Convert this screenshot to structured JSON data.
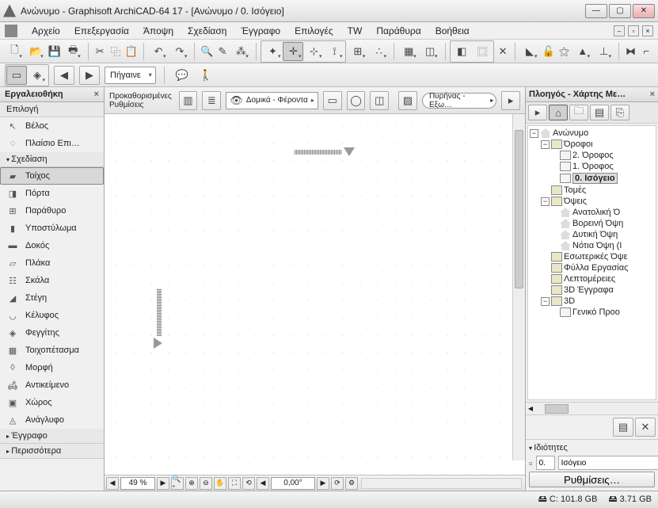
{
  "window": {
    "title": "Ανώνυμο - Graphisoft ArchiCAD-64 17 - [Ανώνυμο / 0. Ισόγειο]"
  },
  "menu": {
    "items": [
      "Αρχείο",
      "Επεξεργασία",
      "Άποψη",
      "Σχεδίαση",
      "Έγγραφο",
      "Επιλογές",
      "TW",
      "Παράθυρα",
      "Βοήθεια"
    ]
  },
  "toolbar2": {
    "go_label": "Πήγαινε"
  },
  "infobar": {
    "presets_label": "Προκαθορισμένες Ρυθμίσεις",
    "layer_label": "Δομικά - Φέροντα",
    "core_label": "Πυρήνας - Εξω…"
  },
  "toolbox": {
    "title": "Εργαλειοθήκη",
    "section_selection": "Επιλογή",
    "section_design": "Σχεδίαση",
    "section_document": "Έγγραφο",
    "section_more": "Περισσότερα",
    "items": {
      "arrow": "Βέλος",
      "marquee": "Πλαίσιο Επι…",
      "wall": "Τοίχος",
      "door": "Πόρτα",
      "window": "Παράθυρο",
      "column": "Υποστύλωμα",
      "beam": "Δοκός",
      "slab": "Πλάκα",
      "stair": "Σκάλα",
      "roof": "Στέγη",
      "shell": "Κέλυφος",
      "skylight": "Φεγγίτης",
      "curtainwall": "Τοιχοπέτασμα",
      "morph": "Μορφή",
      "object": "Αντικείμενο",
      "zone": "Χώρος",
      "mesh": "Ανάγλυφο"
    }
  },
  "navigator": {
    "title": "Πλοηγός - Χάρτης Με…",
    "root": "Ανώνυμο",
    "floors": "Όροφοι",
    "floor2": "2. Όροφος",
    "floor1": "1. Όροφος",
    "floor0": "0. Ισόγειο",
    "sections": "Τομές",
    "elevations": "Όψεις",
    "elev_e": "Ανατολική Ό",
    "elev_n": "Βορεινή Όψη",
    "elev_w": "Δυτική Όψη",
    "elev_s": "Νότια Όψη (Ι",
    "interior": "Εσωτερικές Όψε",
    "worksheets": "Φύλλα Εργασίας",
    "details": "Λεπτομέρειες",
    "docs3d": "3D Έγγραφα",
    "g3d": "3D",
    "generic": "Γενικό Προο",
    "props_title": "Ιδιότητες",
    "props_index": "0.",
    "props_name": "Ισόγειο",
    "settings_btn": "Ρυθμίσεις…"
  },
  "bottombar": {
    "zoom": "49 %",
    "angle": "0,00°"
  },
  "status": {
    "disk_c": "C: 101.8 GB",
    "disk_d": "3.71 GB"
  }
}
